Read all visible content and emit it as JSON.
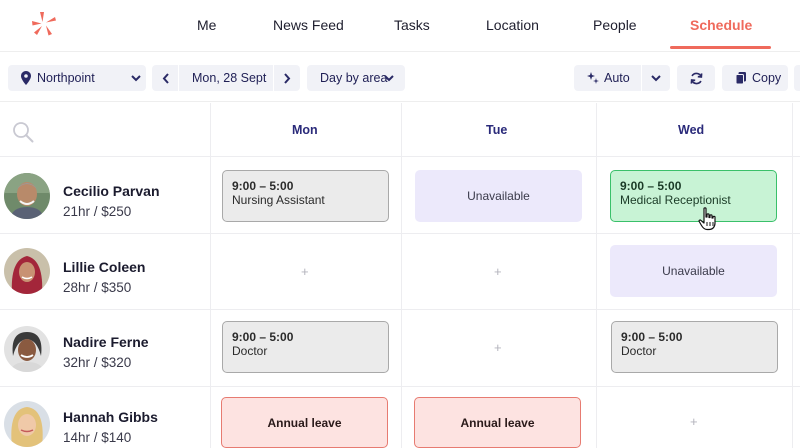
{
  "nav": {
    "items": [
      {
        "label": "Me"
      },
      {
        "label": "News Feed"
      },
      {
        "label": "Tasks"
      },
      {
        "label": "Location"
      },
      {
        "label": "People"
      },
      {
        "label": "Schedule",
        "active": true
      }
    ],
    "accent_color": "#ef6a5c"
  },
  "toolbar": {
    "location": "Northpoint",
    "date": "Mon, 28 Sept",
    "view": "Day by area",
    "auto_label": "Auto",
    "copy_label": "Copy"
  },
  "days": [
    "Mon",
    "Tue",
    "Wed"
  ],
  "people": [
    {
      "name": "Cecilio Parvan",
      "meta": "21hr / $250"
    },
    {
      "name": "Lillie Coleen",
      "meta": "28hr / $350"
    },
    {
      "name": "Nadire Ferne",
      "meta": "32hr / $320"
    },
    {
      "name": "Hannah Gibbs",
      "meta": "14hr / $140"
    }
  ],
  "shifts": {
    "r0_mon": {
      "time": "9:00 – 5:00",
      "role": "Nursing Assistant"
    },
    "r0_tue": {
      "label": "Unavailable"
    },
    "r0_wed": {
      "time": "9:00 – 5:00",
      "role": "Medical Receptionist"
    },
    "r1_wed": {
      "label": "Unavailable"
    },
    "r2_mon": {
      "time": "9:00 – 5:00",
      "role": "Doctor"
    },
    "r2_wed": {
      "time": "9:00 – 5:00",
      "role": "Doctor"
    },
    "r3_mon": {
      "label": "Annual leave"
    },
    "r3_tue": {
      "label": "Annual leave"
    }
  },
  "add_symbol": "+"
}
